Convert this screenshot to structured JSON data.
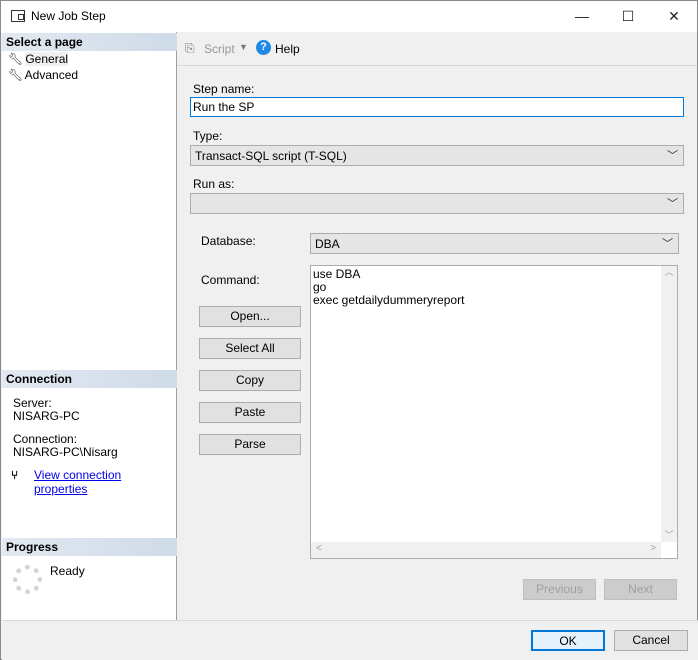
{
  "window": {
    "title": "New Job Step",
    "minimize": "—",
    "maximize": "☐",
    "close": "✕"
  },
  "sidebar": {
    "select_header": "Select a page",
    "pages": [
      {
        "label": "General"
      },
      {
        "label": "Advanced"
      }
    ],
    "connection_header": "Connection",
    "server_label": "Server:",
    "server_value": "NISARG-PC",
    "connection_label": "Connection:",
    "connection_value": "NISARG-PC\\Nisarg",
    "view_link": "View connection properties",
    "progress_header": "Progress",
    "progress_status": "Ready"
  },
  "toolbar": {
    "script": "Script",
    "help": "Help"
  },
  "form": {
    "step_name_label": "Step name:",
    "step_name_value": "Run the SP",
    "type_label": "Type:",
    "type_value": "Transact-SQL script (T-SQL)",
    "run_as_label": "Run as:",
    "run_as_value": "",
    "database_label": "Database:",
    "database_value": "DBA",
    "command_label": "Command:",
    "command_lines": [
      "use DBA",
      "go",
      "exec getdailydummeryreport"
    ],
    "buttons": {
      "open": "Open...",
      "select_all": "Select All",
      "copy": "Copy",
      "paste": "Paste",
      "parse": "Parse"
    },
    "previous": "Previous",
    "next": "Next"
  },
  "footer": {
    "ok": "OK",
    "cancel": "Cancel"
  }
}
